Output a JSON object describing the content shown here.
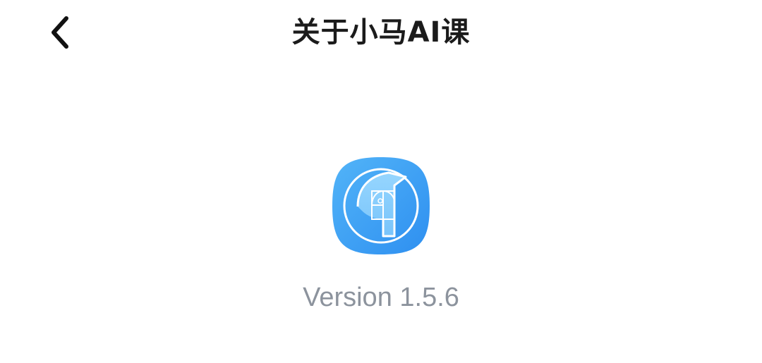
{
  "header": {
    "title": "关于小马AI课",
    "back_icon": "chevron-left-icon"
  },
  "app": {
    "logo_icon": "golden-spiral-logo-icon",
    "version_text": "Version 1.5.6"
  },
  "colors": {
    "title": "#1b1b1b",
    "version": "#8c939d",
    "logo_blue": "#3d9cf0",
    "logo_light": "#8fd0ff"
  }
}
